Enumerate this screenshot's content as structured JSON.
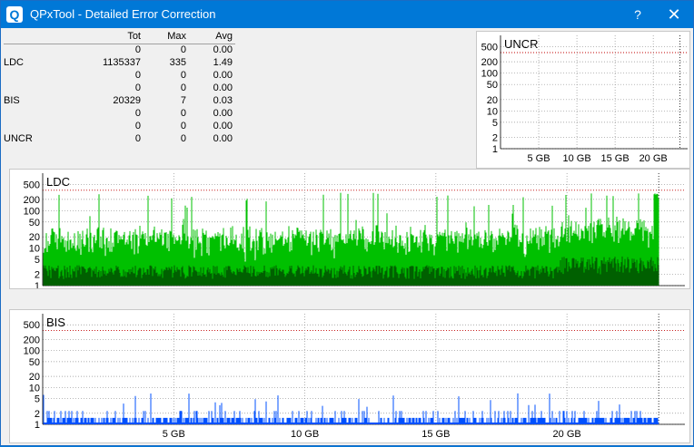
{
  "window": {
    "title": "QPxTool - Detailed Error Correction",
    "help_label": "?",
    "close_label": "✕",
    "icon_label": "Q"
  },
  "stats": {
    "headers": [
      "",
      "Tot",
      "Max",
      "Avg"
    ],
    "rows": [
      [
        "",
        "0",
        "0",
        "0.00"
      ],
      [
        "LDC",
        "1135337",
        "335",
        "1.49"
      ],
      [
        "",
        "0",
        "0",
        "0.00"
      ],
      [
        "",
        "0",
        "0",
        "0.00"
      ],
      [
        "BIS",
        "20329",
        "7",
        "0.03"
      ],
      [
        "",
        "0",
        "0",
        "0.00"
      ],
      [
        "",
        "0",
        "0",
        "0.00"
      ],
      [
        "UNCR",
        "0",
        "0",
        "0.00"
      ]
    ]
  },
  "colors": {
    "ldc_light": "#00c000",
    "ldc_dark": "#006000",
    "bis": "#0050ff",
    "limit": "#c00000",
    "grid": "#909090",
    "titlebar": "#0078d7"
  },
  "chart_data": [
    {
      "type": "bar",
      "title": "UNCR",
      "x_ticks": [
        "5 GB",
        "10 GB",
        "15 GB",
        "20 GB"
      ],
      "y_ticks": [
        "500",
        "200",
        "100",
        "50",
        "20",
        "10",
        "5",
        "2",
        "1"
      ],
      "y_scale": "log",
      "xlim": [
        0,
        24.5
      ],
      "series": [
        {
          "values": []
        }
      ]
    },
    {
      "type": "bar",
      "title": "LDC",
      "x_ticks": [
        "5 GB",
        "10 GB",
        "15 GB",
        "20 GB"
      ],
      "y_ticks": [
        "500",
        "200",
        "100",
        "50",
        "20",
        "10",
        "5",
        "2",
        "1"
      ],
      "y_scale": "log",
      "xlim": [
        0,
        24.5
      ],
      "series": [
        {
          "approx": "dense noise",
          "typical": [
            4,
            15
          ],
          "peak": 335,
          "late_level": [
            8,
            25
          ]
        }
      ]
    },
    {
      "type": "bar",
      "title": "BIS",
      "x_ticks": [
        "5 GB",
        "10 GB",
        "15 GB",
        "20 GB"
      ],
      "y_ticks": [
        "500",
        "200",
        "100",
        "50",
        "20",
        "10",
        "5",
        "2",
        "1"
      ],
      "y_scale": "log",
      "xlim": [
        0,
        24.5
      ],
      "series": [
        {
          "approx": "sparse",
          "typical": [
            1,
            2
          ],
          "peak": 7
        }
      ]
    }
  ]
}
